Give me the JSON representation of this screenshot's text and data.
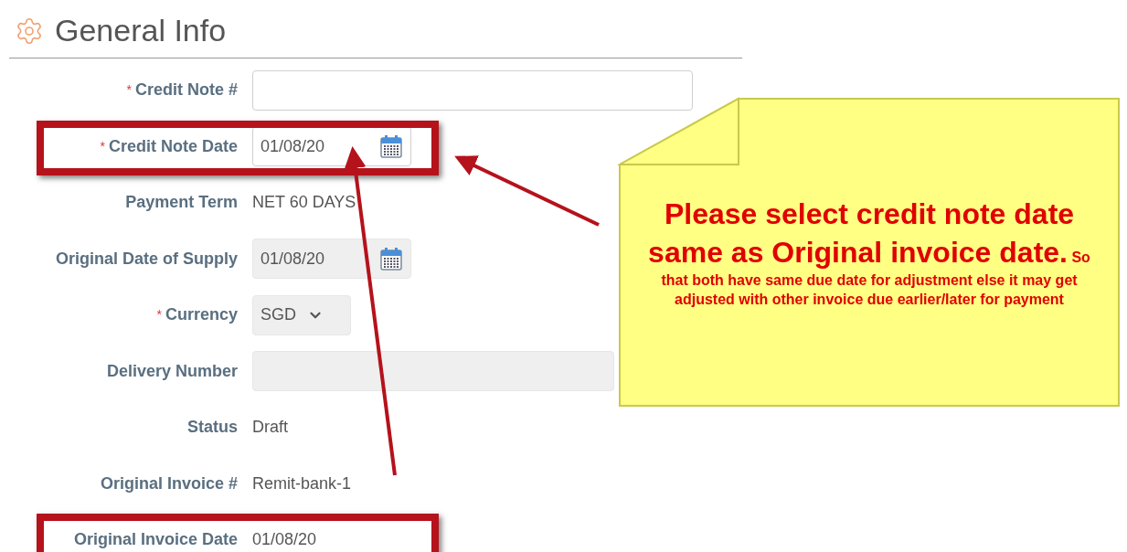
{
  "header": {
    "title": "General Info"
  },
  "fields": [
    {
      "kind": "input",
      "label": "Credit Note #",
      "required_mark": "*",
      "disabled": false,
      "highlighted": false
    },
    {
      "kind": "date",
      "label": "Credit Note Date",
      "value": "01/08/20",
      "required_mark": "*",
      "disabled": false,
      "highlighted": true
    },
    {
      "kind": "text",
      "label": "Payment Term",
      "value": "NET 60 DAYS",
      "highlighted": false
    },
    {
      "kind": "date",
      "label": "Original Date of Supply",
      "value": "01/08/20",
      "disabled": true,
      "highlighted": false
    },
    {
      "kind": "select",
      "label": "Currency",
      "value": "SGD",
      "required_mark": "*",
      "disabled": true,
      "highlighted": false
    },
    {
      "kind": "input",
      "label": "Delivery Number",
      "disabled": true,
      "highlighted": false
    },
    {
      "kind": "text",
      "label": "Status",
      "value": "Draft",
      "highlighted": false
    },
    {
      "kind": "text",
      "label": "Original Invoice #",
      "value": "Remit-bank-1",
      "highlighted": false
    },
    {
      "kind": "text",
      "label": "Original Invoice Date",
      "value": "01/08/20",
      "highlighted": true
    }
  ],
  "note": {
    "headline": "Please select credit note date same as Original invoice date.",
    "detail": "So that both have same due date for adjustment else it may get adjusted with other invoice due earlier/later for payment"
  }
}
